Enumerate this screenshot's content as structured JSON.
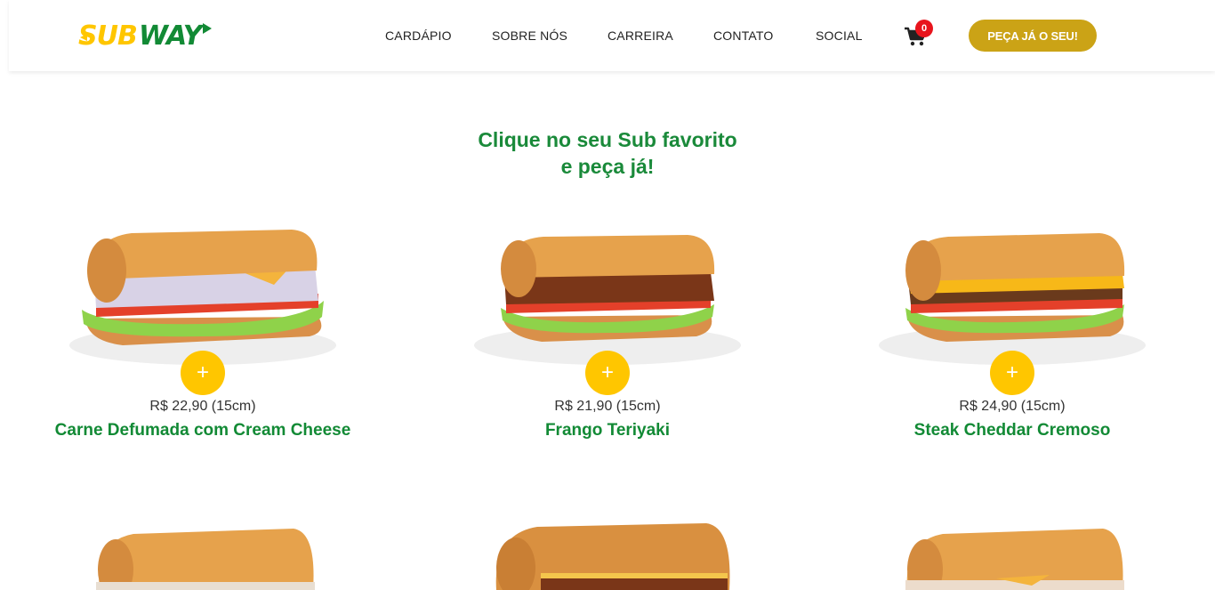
{
  "brand": {
    "logo_text": "SUBWAY",
    "colors": {
      "yellow": "#ffc600",
      "green": "#128a35",
      "gold": "#cba316"
    }
  },
  "nav": {
    "items": [
      "CARDÁPIO",
      "SOBRE NÓS",
      "CARREIRA",
      "CONTATO",
      "SOCIAL"
    ],
    "cart_count": "0",
    "cart_icon": "cart-icon",
    "order_button": "PEÇA JÁ O SEU!"
  },
  "headline": {
    "line1": "Clique no seu Sub favorito",
    "line2": "e peça já!"
  },
  "products": [
    {
      "price": "R$ 22,90 (15cm)",
      "name": "Carne Defumada com Cream Cheese",
      "add_label": "+"
    },
    {
      "price": "R$ 21,90 (15cm)",
      "name": "Frango Teriyaki",
      "add_label": "+"
    },
    {
      "price": "R$ 24,90 (15cm)",
      "name": "Steak Cheddar Cremoso",
      "add_label": "+"
    }
  ]
}
